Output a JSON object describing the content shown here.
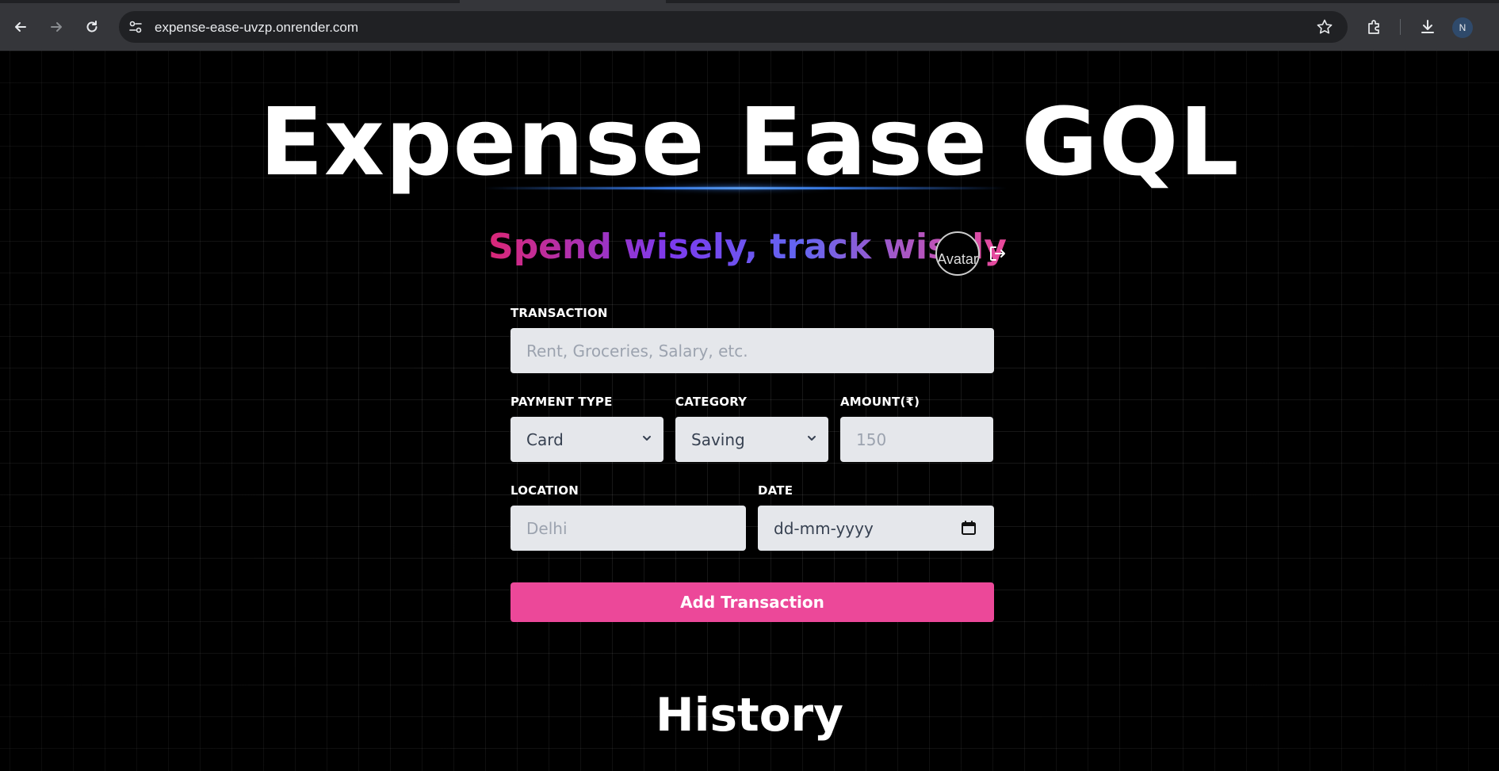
{
  "browser": {
    "url": "expense-ease-uvzp.onrender.com",
    "profile_initial": "N",
    "icons": [
      "back-icon",
      "forward-icon",
      "reload-icon",
      "site-info-icon",
      "bookmark-star-icon",
      "extensions-icon",
      "download-icon"
    ]
  },
  "app": {
    "title": "Expense Ease GQL",
    "tagline": "Spend wisely, track wisely",
    "avatar_alt": "Avatar",
    "logout_icon": "logout-icon"
  },
  "form": {
    "transaction": {
      "label": "TRANSACTION",
      "placeholder": "Rent, Groceries, Salary, etc."
    },
    "payment_type": {
      "label": "PAYMENT TYPE",
      "value": "Card"
    },
    "category": {
      "label": "CATEGORY",
      "value": "Saving"
    },
    "amount": {
      "label": "AMOUNT(₹)",
      "placeholder": "150"
    },
    "location": {
      "label": "LOCATION",
      "placeholder": "Delhi"
    },
    "date": {
      "label": "DATE",
      "placeholder": "dd-mm-yyyy"
    },
    "submit_label": "Add Transaction"
  },
  "history": {
    "heading": "History"
  },
  "colors": {
    "accent": "#ec4899",
    "field_bg": "#e5e7eb",
    "chrome_bg": "#35363a",
    "omnibox_bg": "#202124"
  }
}
